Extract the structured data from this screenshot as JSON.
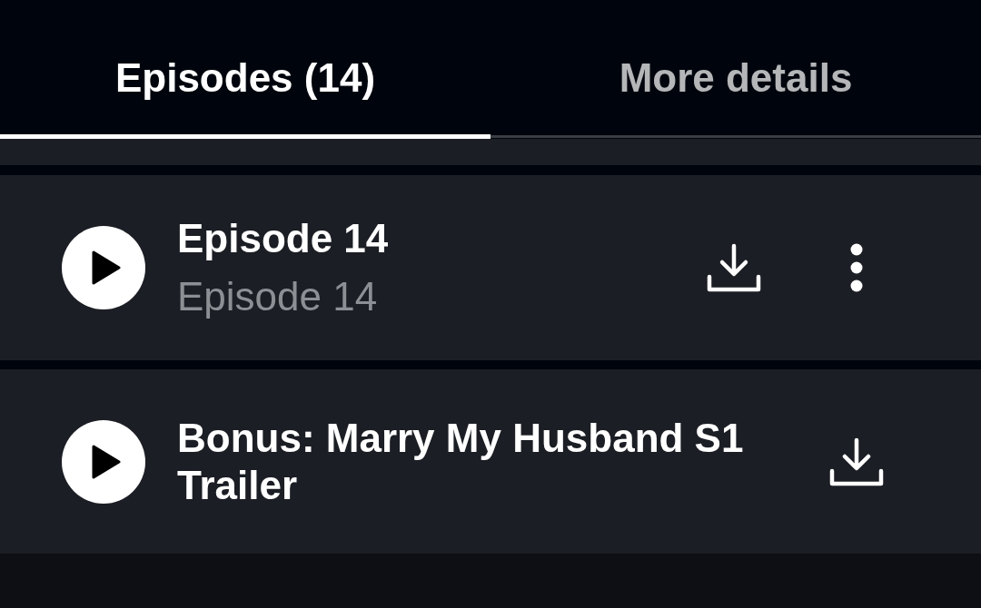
{
  "tabs": [
    {
      "label": "Episodes (14)",
      "selected": true
    },
    {
      "label": "More details",
      "selected": false
    }
  ],
  "episodes": [
    {
      "title": "Episode 14",
      "subtitle": "Episode 14",
      "actions": [
        {
          "kind": "download"
        },
        {
          "kind": "more"
        }
      ]
    },
    {
      "title": "Bonus: Marry My Husband S1 Trailer",
      "actions": [
        {
          "kind": "download"
        }
      ]
    }
  ]
}
